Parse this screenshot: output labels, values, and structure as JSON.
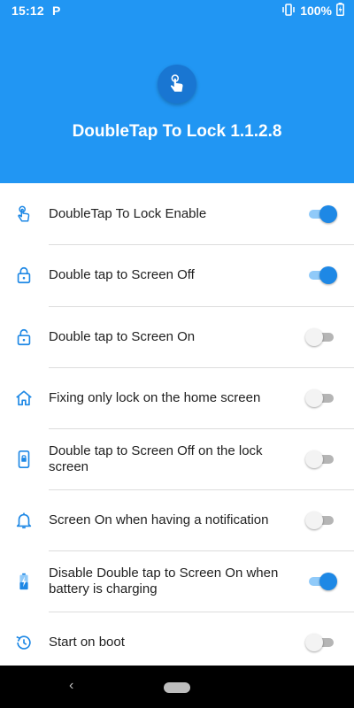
{
  "status_bar": {
    "time": "15:12",
    "app_indicator": "P",
    "battery_percent": "100%",
    "icons": [
      "vibrate-icon",
      "battery-charging-icon"
    ]
  },
  "header": {
    "title": "DoubleTap To Lock 1.1.2.8",
    "icon": "tap-finger-icon",
    "background_color": "#2196F3"
  },
  "settings": [
    {
      "label": "DoubleTap To Lock Enable",
      "icon": "tap-finger-icon",
      "enabled": true
    },
    {
      "label": "Double tap to Screen Off",
      "icon": "lock-icon",
      "enabled": true
    },
    {
      "label": "Double tap to Screen On",
      "icon": "unlock-icon",
      "enabled": false
    },
    {
      "label": "Fixing only lock on the home screen",
      "icon": "home-icon",
      "enabled": false
    },
    {
      "label": "Double tap to Screen Off on the lock screen",
      "icon": "phone-lock-icon",
      "enabled": false
    },
    {
      "label": "Screen On when having a notification",
      "icon": "bell-icon",
      "enabled": false
    },
    {
      "label": "Disable Double tap to Screen On when battery is charging",
      "icon": "battery-charging-icon",
      "enabled": true
    },
    {
      "label": "Start on boot",
      "icon": "history-icon",
      "enabled": false
    }
  ],
  "colors": {
    "accent": "#1E88E5",
    "accent_track": "#90CAF9",
    "icon": "#1E88E5"
  },
  "nav_bar": {
    "back_icon": "back-chevron-icon",
    "home_icon": "home-pill-icon"
  }
}
